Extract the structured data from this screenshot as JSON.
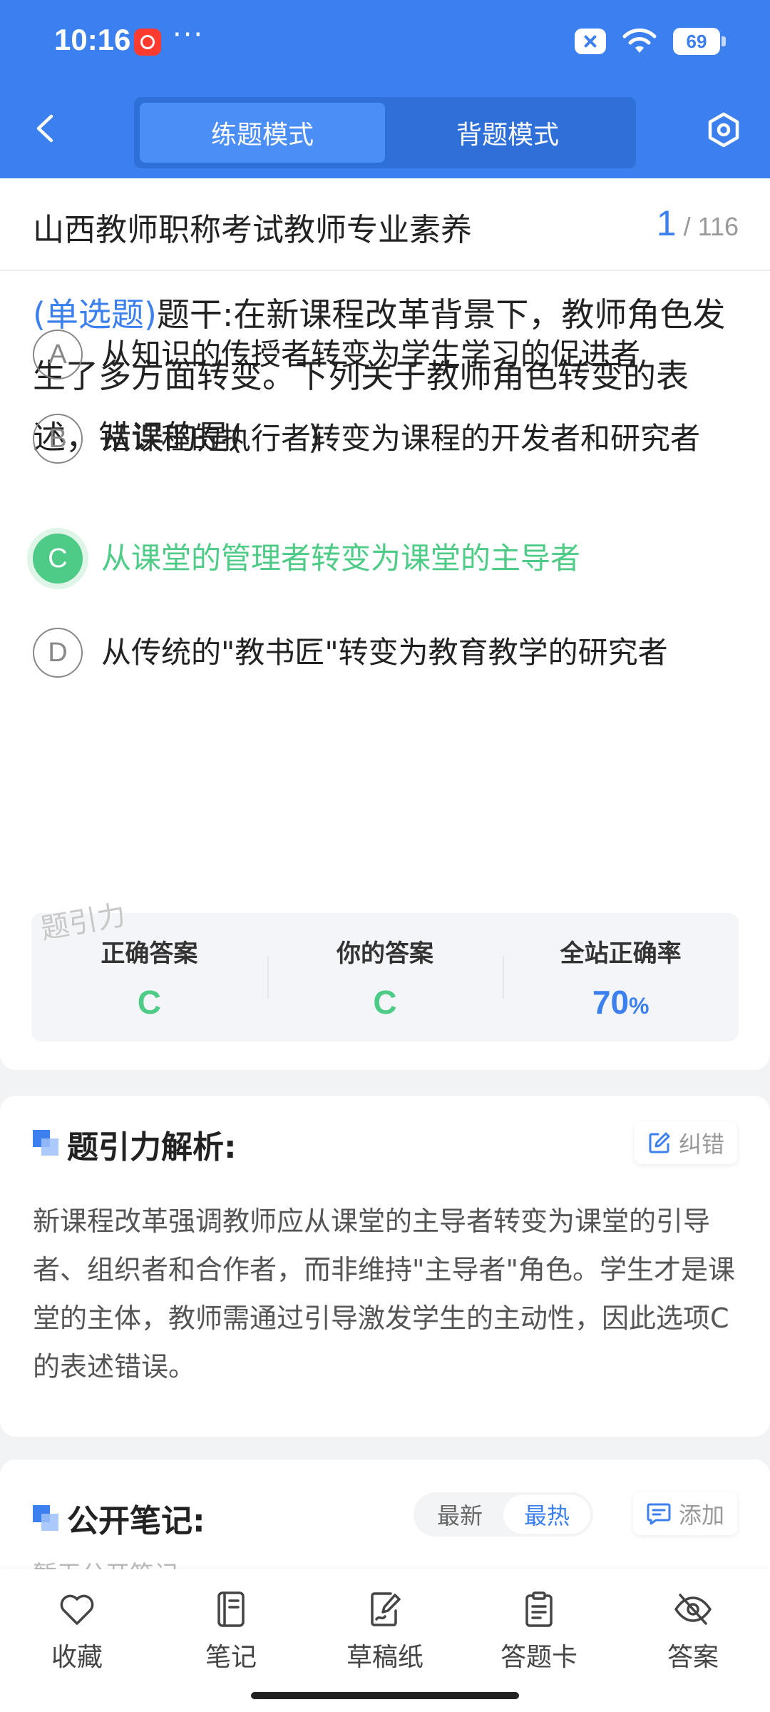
{
  "status_bar": {
    "time": "10:16",
    "dots": "···",
    "battery": "69"
  },
  "nav": {
    "modes": [
      "练题模式",
      "背题模式"
    ],
    "active_mode": 0
  },
  "paper": {
    "title": "山西教师职称考试教师专业素养",
    "current": "1",
    "separator": "/",
    "total": "116"
  },
  "question": {
    "type": "(单选题)",
    "stem": "题干:在新课程改革背景下，教师角色发生了多方面转变。下列关于教师角色转变的表述，错误的是(　　)",
    "options": [
      {
        "letter": "A",
        "text": "从知识的传授者转变为学生学习的促进者"
      },
      {
        "letter": "B",
        "text": "从课程的执行者转变为课程的开发者和研究者"
      },
      {
        "letter": "C",
        "text": "从课堂的管理者转变为课堂的主导者"
      },
      {
        "letter": "D",
        "text": "从传统的\"教书匠\"转变为教育教学的研究者"
      }
    ],
    "correct_index": 2
  },
  "watermark": "题引力",
  "stats": {
    "correct_label": "正确答案",
    "correct_value": "C",
    "yours_label": "你的答案",
    "yours_value": "C",
    "rate_label": "全站正确率",
    "rate_value": "70",
    "rate_unit": "%"
  },
  "analysis": {
    "title": "题引力解析:",
    "report_label": "纠错",
    "text": "新课程改革强调教师应从课堂的主导者转变为课堂的引导者、组织者和合作者，而非维持\"主导者\"角色。学生才是课堂的主体，教师需通过引导激发学生的主动性，因此选项C的表述错误。"
  },
  "notes": {
    "title": "公开笔记:",
    "sort_options": [
      "最新",
      "最热"
    ],
    "active_sort": 1,
    "add_label": "添加",
    "empty_text": "暂无公开笔记"
  },
  "toolbar": {
    "favorite": "收藏",
    "notes": "笔记",
    "scratch": "草稿纸",
    "answer_card": "答题卡",
    "answer": "答案"
  },
  "colors": {
    "brand_blue": "#3c80ef",
    "correct_green": "#4ecb86"
  }
}
